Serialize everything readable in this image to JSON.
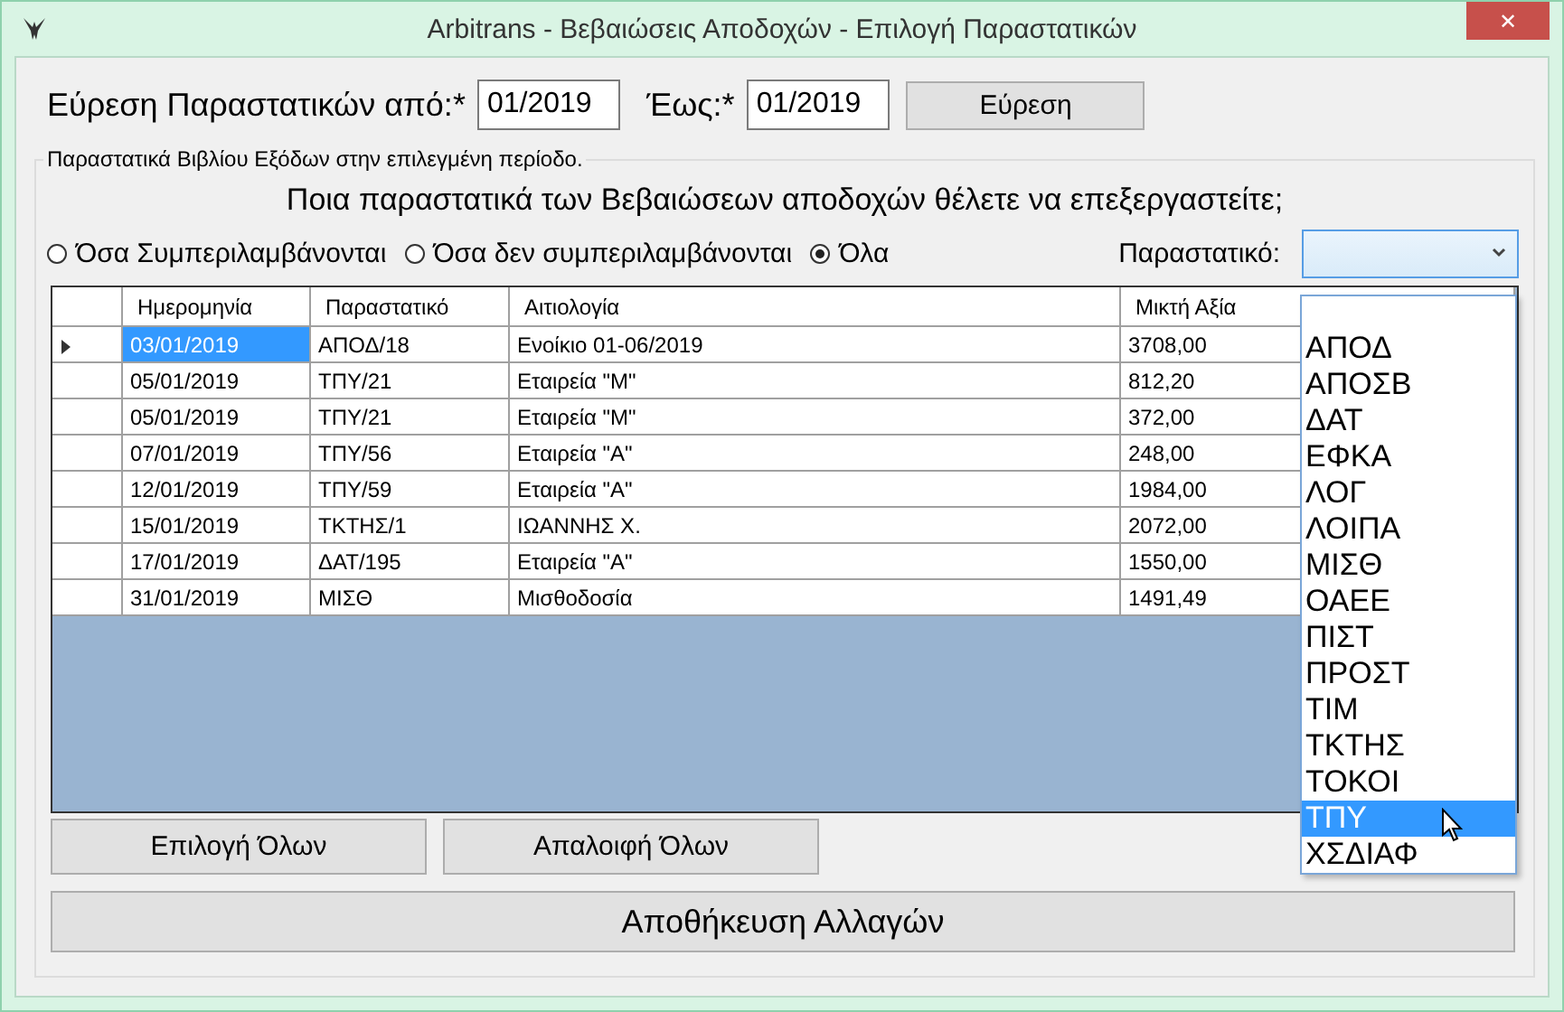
{
  "window": {
    "title": "Arbitrans - Βεβαιώσεις Αποδοχών - Επιλογή Παραστατικών",
    "close": "✕"
  },
  "search": {
    "from_label": "Εύρεση Παραστατικών από:*",
    "from_value": "01/2019",
    "to_label": "Έως:*",
    "to_value": "01/2019",
    "button": "Εύρεση"
  },
  "group": {
    "title": "Παραστατικά Βιβλίου Εξόδων στην επιλεγμένη περίοδο."
  },
  "question": "Ποια παραστατικά των Βεβαιώσεων αποδοχών θέλετε να επεξεργαστείτε;",
  "filters": [
    {
      "label": "Όσα Συμπεριλαμβάνονται",
      "selected": false
    },
    {
      "label": "Όσα δεν συμπεριλαμβάνονται",
      "selected": false
    },
    {
      "label": "Όλα",
      "selected": true
    }
  ],
  "doc_filter": {
    "label": "Παραστατικό:",
    "expanded": true,
    "options": [
      {
        "label": "ΑΠΟΔ",
        "selected": false
      },
      {
        "label": "ΑΠΟΣΒ",
        "selected": false
      },
      {
        "label": "ΔΑΤ",
        "selected": false
      },
      {
        "label": "ΕΦΚΑ",
        "selected": false
      },
      {
        "label": "ΛΟΓ",
        "selected": false
      },
      {
        "label": "ΛΟΙΠΑ",
        "selected": false
      },
      {
        "label": "ΜΙΣΘ",
        "selected": false
      },
      {
        "label": "ΟΑΕΕ",
        "selected": false
      },
      {
        "label": "ΠΙΣΤ",
        "selected": false
      },
      {
        "label": "ΠΡΟΣΤ",
        "selected": false
      },
      {
        "label": "ΤΙΜ",
        "selected": false
      },
      {
        "label": "ΤΚΤΗΣ",
        "selected": false
      },
      {
        "label": "ΤΟΚΟΙ",
        "selected": false
      },
      {
        "label": "ΤΠΥ",
        "selected": true
      },
      {
        "label": "ΧΣΔΙΑΦ",
        "selected": false
      }
    ]
  },
  "table": {
    "columns": [
      "Ημερομηνία",
      "Παραστατικό",
      "Αιτιολογία",
      "Μικτή Αξία"
    ],
    "rows": [
      {
        "current": true,
        "cells": [
          "03/01/2019",
          "ΑΠΟΔ/18",
          "Ενοίκιο 01-06/2019",
          "3708,00"
        ]
      },
      {
        "current": false,
        "cells": [
          "05/01/2019",
          "ΤΠΥ/21",
          "Εταιρεία \"Μ\"",
          "812,20"
        ]
      },
      {
        "current": false,
        "cells": [
          "05/01/2019",
          "ΤΠΥ/21",
          "Εταιρεία \"Μ\"",
          "372,00"
        ]
      },
      {
        "current": false,
        "cells": [
          "07/01/2019",
          "ΤΠΥ/56",
          "Εταιρεία \"Α\"",
          "248,00"
        ]
      },
      {
        "current": false,
        "cells": [
          "12/01/2019",
          "ΤΠΥ/59",
          "Εταιρεία \"Α\"",
          "1984,00"
        ]
      },
      {
        "current": false,
        "cells": [
          "15/01/2019",
          "ΤΚΤΗΣ/1",
          "ΙΩΑΝΝΗΣ Χ.",
          "2072,00"
        ]
      },
      {
        "current": false,
        "cells": [
          "17/01/2019",
          "ΔΑΤ/195",
          "Εταιρεία \"Α\"",
          "1550,00"
        ]
      },
      {
        "current": false,
        "cells": [
          "31/01/2019",
          "ΜΙΣΘ",
          "Μισθοδοσία",
          "1491,49"
        ]
      }
    ]
  },
  "buttons": {
    "select_all": "Επιλογή Όλων",
    "clear_all": "Απαλοιφή Όλων",
    "save": "Αποθήκευση Αλλαγών"
  }
}
